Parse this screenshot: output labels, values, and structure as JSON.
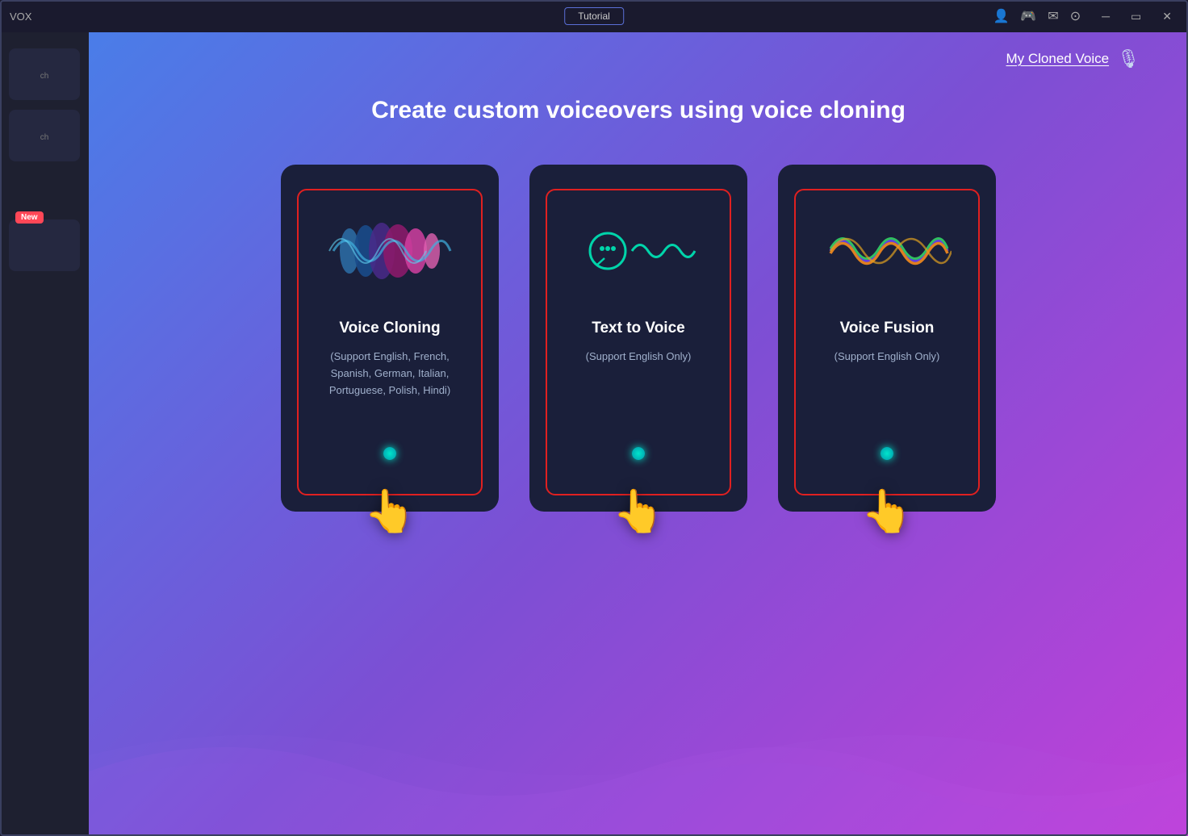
{
  "titlebar": {
    "logo": "VOX",
    "tutorial_label": "Tutorial",
    "icons": [
      "user",
      "gamepad",
      "mail",
      "settings"
    ],
    "controls": [
      "minimize",
      "maximize",
      "close"
    ]
  },
  "sidebar": {
    "items": [
      {
        "label": "ch",
        "has_new": false
      },
      {
        "label": "ch",
        "has_new": false
      },
      {
        "label": "New",
        "has_new": true
      }
    ],
    "new_badge": "New"
  },
  "header": {
    "cloned_voice_link": "My Cloned Voice"
  },
  "main": {
    "heading": "Create custom voiceovers using voice cloning",
    "cards": [
      {
        "id": "voice-cloning",
        "title": "Voice Cloning",
        "subtitle": "(Support English, French, Spanish, German, Italian, Portuguese, Polish, Hindi)"
      },
      {
        "id": "text-to-voice",
        "title": "Text to Voice",
        "subtitle": "(Support English Only)"
      },
      {
        "id": "voice-fusion",
        "title": "Voice Fusion",
        "subtitle": "(Support English Only)"
      }
    ]
  }
}
